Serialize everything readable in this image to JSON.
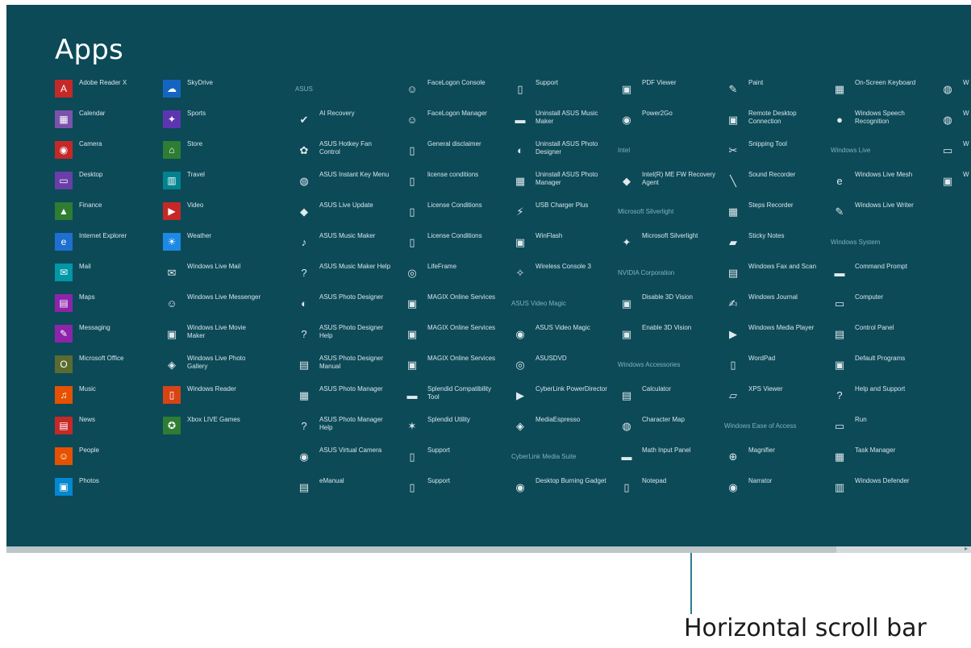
{
  "screen": {
    "title": "Apps"
  },
  "annotation": {
    "label": "Horizontal scroll bar"
  },
  "colors": {
    "background": "#0c4a58",
    "text": "#d8e6ea",
    "group_heading": "#7fb3c0",
    "scroll_track": "#d4dadc",
    "scroll_thumb": "#bcc5c8",
    "callout_line": "#2b7f93"
  },
  "scrollbar": {
    "thumb_position": 0.0,
    "visible_fraction": 0.86
  },
  "columns": [
    {
      "items": [
        {
          "kind": "app",
          "label": "Adobe Reader X",
          "color": "#c62828",
          "icon": "A",
          "icon_name": "pdf-icon"
        },
        {
          "kind": "app",
          "label": "Calendar",
          "color": "#7b52ab",
          "icon": "▦",
          "icon_name": "calendar-icon"
        },
        {
          "kind": "app",
          "label": "Camera",
          "color": "#c62828",
          "icon": "◉",
          "icon_name": "camera-icon"
        },
        {
          "kind": "app",
          "label": "Desktop",
          "color": "#6a3ea8",
          "icon": "▭",
          "icon_name": "desktop-icon"
        },
        {
          "kind": "app",
          "label": "Finance",
          "color": "#2e7d32",
          "icon": "▲",
          "icon_name": "chart-icon"
        },
        {
          "kind": "app",
          "label": "Internet Explorer",
          "color": "#1e6fd0",
          "icon": "e",
          "icon_name": "browser-icon"
        },
        {
          "kind": "app",
          "label": "Mail",
          "color": "#0097a7",
          "icon": "✉",
          "icon_name": "mail-icon"
        },
        {
          "kind": "app",
          "label": "Maps",
          "color": "#8e24aa",
          "icon": "▤",
          "icon_name": "map-icon"
        },
        {
          "kind": "app",
          "label": "Messaging",
          "color": "#8e24aa",
          "icon": "✎",
          "icon_name": "message-icon"
        },
        {
          "kind": "app",
          "label": "Microsoft Office",
          "color": "#5b6b2f",
          "icon": "O",
          "icon_name": "office-icon"
        },
        {
          "kind": "app",
          "label": "Music",
          "color": "#e65100",
          "icon": "♫",
          "icon_name": "music-icon"
        },
        {
          "kind": "app",
          "label": "News",
          "color": "#c62828",
          "icon": "▤",
          "icon_name": "news-icon"
        },
        {
          "kind": "app",
          "label": "People",
          "color": "#e65100",
          "icon": "☺",
          "icon_name": "people-icon"
        },
        {
          "kind": "app",
          "label": "Photos",
          "color": "#0288d1",
          "icon": "▣",
          "icon_name": "photo-icon"
        }
      ]
    },
    {
      "items": [
        {
          "kind": "app",
          "label": "SkyDrive",
          "color": "#1565c0",
          "icon": "☁",
          "icon_name": "cloud-icon"
        },
        {
          "kind": "app",
          "label": "Sports",
          "color": "#5e35b1",
          "icon": "✦",
          "icon_name": "trophy-icon"
        },
        {
          "kind": "app",
          "label": "Store",
          "color": "#2e7d32",
          "icon": "⌂",
          "icon_name": "store-icon"
        },
        {
          "kind": "app",
          "label": "Travel",
          "color": "#00838f",
          "icon": "▥",
          "icon_name": "travel-icon"
        },
        {
          "kind": "app",
          "label": "Video",
          "color": "#c62828",
          "icon": "▶",
          "icon_name": "video-icon"
        },
        {
          "kind": "app",
          "label": "Weather",
          "color": "#1e88e5",
          "icon": "☀",
          "icon_name": "weather-icon"
        },
        {
          "kind": "desk",
          "label": "Windows Live Mail",
          "icon": "✉",
          "icon_name": "envelope-icon"
        },
        {
          "kind": "desk",
          "label": "Windows Live Messenger",
          "icon": "☺",
          "icon_name": "messenger-icon"
        },
        {
          "kind": "desk",
          "label": "Windows Live Movie Maker",
          "icon": "▣",
          "icon_name": "film-icon"
        },
        {
          "kind": "desk",
          "label": "Windows Live Photo Gallery",
          "icon": "◈",
          "icon_name": "gallery-icon"
        },
        {
          "kind": "app",
          "label": "Windows Reader",
          "color": "#d84315",
          "icon": "▯",
          "icon_name": "reader-icon"
        },
        {
          "kind": "app",
          "label": "Xbox LIVE Games",
          "color": "#2e7d32",
          "icon": "✪",
          "icon_name": "xbox-icon"
        }
      ]
    },
    {
      "items": [
        {
          "kind": "group",
          "label": "ASUS"
        },
        {
          "kind": "desk",
          "label": "AI Recovery",
          "icon": "✔",
          "icon_name": "check-icon"
        },
        {
          "kind": "desk",
          "label": "ASUS Hotkey Fan Control",
          "icon": "✿",
          "icon_name": "fan-icon"
        },
        {
          "kind": "desk",
          "label": "ASUS Instant Key Menu",
          "icon": "◍",
          "icon_name": "key-icon"
        },
        {
          "kind": "desk",
          "label": "ASUS Live Update",
          "icon": "◆",
          "icon_name": "update-icon"
        },
        {
          "kind": "desk",
          "label": "ASUS Music Maker",
          "icon": "♪",
          "icon_name": "music-maker-icon"
        },
        {
          "kind": "desk",
          "label": "ASUS Music Maker Help",
          "icon": "?",
          "icon_name": "help-icon"
        },
        {
          "kind": "desk",
          "label": "ASUS Photo Designer",
          "icon": "◐",
          "icon_name": "photo-designer-icon"
        },
        {
          "kind": "desk",
          "label": "ASUS Photo Designer Help",
          "icon": "?",
          "icon_name": "help-icon"
        },
        {
          "kind": "desk",
          "label": "ASUS Photo Designer Manual",
          "icon": "▤",
          "icon_name": "manual-icon"
        },
        {
          "kind": "desk",
          "label": "ASUS Photo Manager",
          "icon": "▦",
          "icon_name": "photo-manager-icon"
        },
        {
          "kind": "desk",
          "label": "ASUS Photo Manager Help",
          "icon": "?",
          "icon_name": "help-icon"
        },
        {
          "kind": "desk",
          "label": "ASUS Virtual Camera",
          "icon": "◉",
          "icon_name": "webcam-icon"
        },
        {
          "kind": "desk",
          "label": "eManual",
          "icon": "▤",
          "icon_name": "book-icon"
        }
      ]
    },
    {
      "items": [
        {
          "kind": "desk",
          "label": "FaceLogon Console",
          "icon": "☺",
          "icon_name": "face-icon"
        },
        {
          "kind": "desk",
          "label": "FaceLogon Manager",
          "icon": "☺",
          "icon_name": "face-manager-icon"
        },
        {
          "kind": "desk",
          "label": "General disclaimer",
          "icon": "▯",
          "icon_name": "document-icon"
        },
        {
          "kind": "desk",
          "label": "license conditions",
          "icon": "▯",
          "icon_name": "document-icon"
        },
        {
          "kind": "desk",
          "label": "License Conditions",
          "icon": "▯",
          "icon_name": "document-icon"
        },
        {
          "kind": "desk",
          "label": "License Conditions",
          "icon": "▯",
          "icon_name": "document-icon"
        },
        {
          "kind": "desk",
          "label": "LifeFrame",
          "icon": "◎",
          "icon_name": "lifeframe-icon"
        },
        {
          "kind": "desk",
          "label": "MAGIX Online Services",
          "icon": "▣",
          "icon_name": "magix-icon"
        },
        {
          "kind": "desk",
          "label": "MAGIX Online Services",
          "icon": "▣",
          "icon_name": "magix-icon"
        },
        {
          "kind": "desk",
          "label": "MAGIX Online Services",
          "icon": "▣",
          "icon_name": "magix-icon"
        },
        {
          "kind": "desk",
          "label": "Splendid Compatibility Tool",
          "icon": "▬",
          "icon_name": "splendid-tool-icon"
        },
        {
          "kind": "desk",
          "label": "Splendid Utility",
          "icon": "✶",
          "icon_name": "splendid-icon"
        },
        {
          "kind": "desk",
          "label": "Support",
          "icon": "▯",
          "icon_name": "support-icon"
        },
        {
          "kind": "desk",
          "label": "Support",
          "icon": "▯",
          "icon_name": "support-icon"
        }
      ]
    },
    {
      "items": [
        {
          "kind": "desk",
          "label": "Support",
          "icon": "▯",
          "icon_name": "support-icon"
        },
        {
          "kind": "desk",
          "label": "Uninstall ASUS Music Maker",
          "icon": "▬",
          "icon_name": "uninstall-icon"
        },
        {
          "kind": "desk",
          "label": "Uninstall ASUS Photo Designer",
          "icon": "◐",
          "icon_name": "uninstall-icon"
        },
        {
          "kind": "desk",
          "label": "Uninstall ASUS Photo Manager",
          "icon": "▦",
          "icon_name": "uninstall-icon"
        },
        {
          "kind": "desk",
          "label": "USB Charger Plus",
          "icon": "⚡",
          "icon_name": "usb-icon"
        },
        {
          "kind": "desk",
          "label": "WinFlash",
          "icon": "▣",
          "icon_name": "flash-icon"
        },
        {
          "kind": "desk",
          "label": "Wireless Console 3",
          "icon": "✧",
          "icon_name": "wireless-icon"
        },
        {
          "kind": "group",
          "label": "ASUS Video Magic"
        },
        {
          "kind": "desk",
          "label": "ASUS Video Magic",
          "icon": "◉",
          "icon_name": "video-magic-icon"
        },
        {
          "kind": "desk",
          "label": "ASUSDVD",
          "icon": "◎",
          "icon_name": "dvd-icon"
        },
        {
          "kind": "desk",
          "label": "CyberLink PowerDirector",
          "icon": "▶",
          "icon_name": "powerdirector-icon"
        },
        {
          "kind": "desk",
          "label": "MediaEspresso",
          "icon": "◈",
          "icon_name": "espresso-icon"
        },
        {
          "kind": "group",
          "label": "CyberLink Media Suite"
        },
        {
          "kind": "desk",
          "label": "Desktop Burning Gadget",
          "icon": "◉",
          "icon_name": "burning-icon"
        }
      ]
    },
    {
      "items": [
        {
          "kind": "desk",
          "label": "PDF Viewer",
          "icon": "▣",
          "icon_name": "pdf-viewer-icon"
        },
        {
          "kind": "desk",
          "label": "Power2Go",
          "icon": "◉",
          "icon_name": "power2go-icon"
        },
        {
          "kind": "group",
          "label": "Intel"
        },
        {
          "kind": "desk",
          "label": "Intel(R) ME FW Recovery Agent",
          "icon": "◆",
          "icon_name": "intel-icon"
        },
        {
          "kind": "group",
          "label": "Microsoft Silverlight"
        },
        {
          "kind": "desk",
          "label": "Microsoft Silverlight",
          "icon": "✦",
          "icon_name": "silverlight-icon"
        },
        {
          "kind": "group",
          "label": "NVIDIA Corporation"
        },
        {
          "kind": "desk",
          "label": "Disable 3D Vision",
          "icon": "▣",
          "icon_name": "3d-vision-icon"
        },
        {
          "kind": "desk",
          "label": "Enable 3D Vision",
          "icon": "▣",
          "icon_name": "3d-vision-icon"
        },
        {
          "kind": "group",
          "label": "Windows Accessories"
        },
        {
          "kind": "desk",
          "label": "Calculator",
          "icon": "▤",
          "icon_name": "calculator-icon"
        },
        {
          "kind": "desk",
          "label": "Character Map",
          "icon": "◍",
          "icon_name": "character-map-icon"
        },
        {
          "kind": "desk",
          "label": "Math Input Panel",
          "icon": "▬",
          "icon_name": "math-icon"
        },
        {
          "kind": "desk",
          "label": "Notepad",
          "icon": "▯",
          "icon_name": "notepad-icon"
        }
      ]
    },
    {
      "items": [
        {
          "kind": "desk",
          "label": "Paint",
          "icon": "✎",
          "icon_name": "paint-icon"
        },
        {
          "kind": "desk",
          "label": "Remote Desktop Connection",
          "icon": "▣",
          "icon_name": "remote-desktop-icon"
        },
        {
          "kind": "desk",
          "label": "Snipping Tool",
          "icon": "✂",
          "icon_name": "scissors-icon"
        },
        {
          "kind": "desk",
          "label": "Sound Recorder",
          "icon": "╲",
          "icon_name": "microphone-icon"
        },
        {
          "kind": "desk",
          "label": "Steps Recorder",
          "icon": "▦",
          "icon_name": "steps-icon"
        },
        {
          "kind": "desk",
          "label": "Sticky Notes",
          "icon": "▰",
          "icon_name": "sticky-notes-icon"
        },
        {
          "kind": "desk",
          "label": "Windows Fax and Scan",
          "icon": "▤",
          "icon_name": "fax-icon"
        },
        {
          "kind": "desk",
          "label": "Windows Journal",
          "icon": "✍",
          "icon_name": "journal-icon"
        },
        {
          "kind": "desk",
          "label": "Windows Media Player",
          "icon": "▶",
          "icon_name": "media-player-icon"
        },
        {
          "kind": "desk",
          "label": "WordPad",
          "icon": "▯",
          "icon_name": "wordpad-icon"
        },
        {
          "kind": "desk",
          "label": "XPS Viewer",
          "icon": "▱",
          "icon_name": "xps-icon"
        },
        {
          "kind": "group",
          "label": "Windows Ease of Access"
        },
        {
          "kind": "desk",
          "label": "Magnifier",
          "icon": "⊕",
          "icon_name": "magnifier-icon"
        },
        {
          "kind": "desk",
          "label": "Narrator",
          "icon": "◉",
          "icon_name": "narrator-icon"
        }
      ]
    },
    {
      "items": [
        {
          "kind": "desk",
          "label": "On-Screen Keyboard",
          "icon": "▦",
          "icon_name": "keyboard-icon"
        },
        {
          "kind": "desk",
          "label": "Windows Speech Recognition",
          "icon": "●",
          "icon_name": "speech-icon"
        },
        {
          "kind": "group",
          "label": "Windows Live"
        },
        {
          "kind": "desk",
          "label": "Windows Live Mesh",
          "icon": "e",
          "icon_name": "mesh-icon"
        },
        {
          "kind": "desk",
          "label": "Windows Live Writer",
          "icon": "✎",
          "icon_name": "writer-icon"
        },
        {
          "kind": "group",
          "label": "Windows System"
        },
        {
          "kind": "desk",
          "label": "Command Prompt",
          "icon": "▬",
          "icon_name": "command-prompt-icon"
        },
        {
          "kind": "desk",
          "label": "Computer",
          "icon": "▭",
          "icon_name": "computer-icon"
        },
        {
          "kind": "desk",
          "label": "Control Panel",
          "icon": "▤",
          "icon_name": "control-panel-icon"
        },
        {
          "kind": "desk",
          "label": "Default Programs",
          "icon": "▣",
          "icon_name": "default-programs-icon"
        },
        {
          "kind": "desk",
          "label": "Help and Support",
          "icon": "?",
          "icon_name": "help-support-icon"
        },
        {
          "kind": "desk",
          "label": "Run",
          "icon": "▭",
          "icon_name": "run-icon"
        },
        {
          "kind": "desk",
          "label": "Task Manager",
          "icon": "▦",
          "icon_name": "task-manager-icon"
        },
        {
          "kind": "desk",
          "label": "Windows Defender",
          "icon": "▥",
          "icon_name": "defender-icon"
        }
      ]
    },
    {
      "items": [
        {
          "kind": "desk",
          "label": "W",
          "icon": "◍",
          "icon_name": "windows-item-icon"
        },
        {
          "kind": "desk",
          "label": "W",
          "icon": "◍",
          "icon_name": "windows-item-icon"
        },
        {
          "kind": "desk",
          "label": "W",
          "icon": "▭",
          "icon_name": "folder-icon"
        },
        {
          "kind": "desk",
          "label": "W",
          "icon": "▣",
          "icon_name": "windows-item-icon"
        }
      ]
    }
  ]
}
